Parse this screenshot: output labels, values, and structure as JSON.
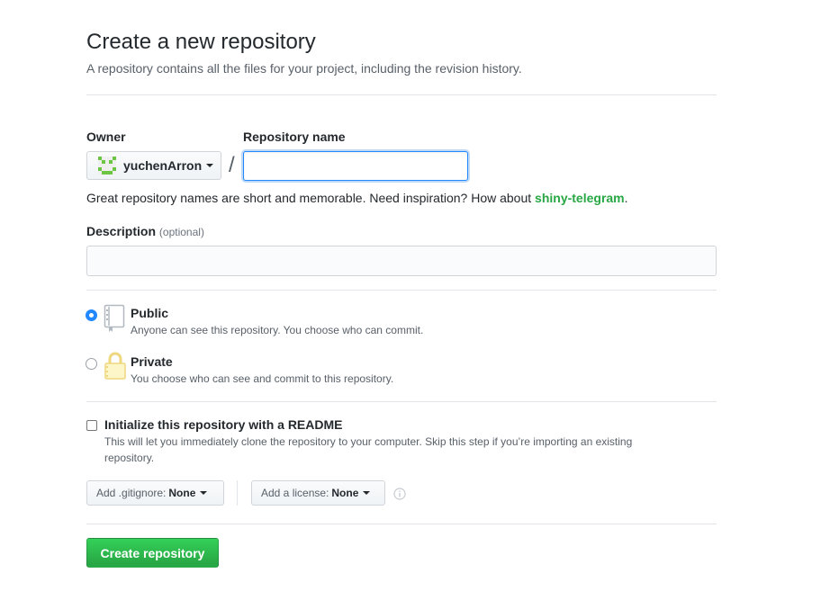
{
  "header": {
    "title": "Create a new repository",
    "subtitle": "A repository contains all the files for your project, including the revision history."
  },
  "owner": {
    "label": "Owner",
    "value": "yuchenArron",
    "avatar_icon": "identicon-avatar",
    "avatar_color": "#6cc644"
  },
  "separator": "/",
  "repo_name": {
    "label": "Repository name",
    "value": ""
  },
  "hint": {
    "text": "Great repository names are short and memorable. Need inspiration? How about ",
    "suggestion": "shiny-telegram",
    "end": "."
  },
  "description": {
    "label": "Description",
    "optional": "(optional)",
    "value": ""
  },
  "visibility": {
    "public": {
      "title": "Public",
      "note": "Anyone can see this repository. You choose who can commit.",
      "selected": true,
      "icon": "repo-book-icon"
    },
    "private": {
      "title": "Private",
      "note": "You choose who can see and commit to this repository.",
      "selected": false,
      "icon": "lock-icon"
    }
  },
  "readme": {
    "title": "Initialize this repository with a README",
    "note_line1": "This will let you immediately clone the repository to your computer. Skip this step if you’re importing an existing",
    "note_line2": "repository.",
    "checked": false
  },
  "gitignore": {
    "label": "Add .gitignore:",
    "value": "None"
  },
  "license": {
    "label": "Add a license:",
    "value": "None"
  },
  "info_icon": "info-icon",
  "submit": {
    "label": "Create repository"
  },
  "colors": {
    "accent_blue": "#2188ff",
    "success_green": "#28a745",
    "muted_text": "#586069"
  }
}
